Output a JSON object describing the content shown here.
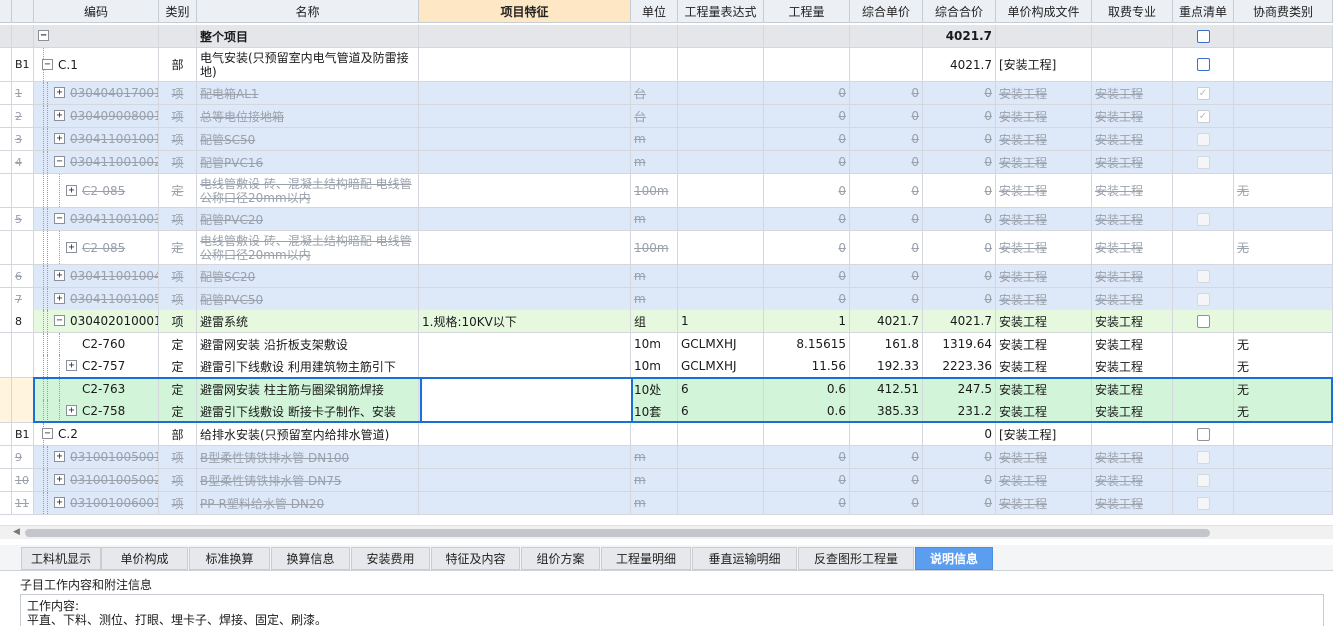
{
  "columns": {
    "code": "编码",
    "cat": "类别",
    "name": "名称",
    "feat": "项目特征",
    "unit": "单位",
    "expr": "工程量表达式",
    "qty": "工程量",
    "up": "综合单价",
    "tp": "综合合价",
    "file": "单价构成文件",
    "fee": "取费专业",
    "key": "重点清单",
    "neg": "协商费类别"
  },
  "rows": [
    {
      "seq": "",
      "code": "",
      "cat": "",
      "name": "整个项目",
      "feat": "",
      "unit": "",
      "expr": "",
      "qty": "",
      "up": "",
      "tp": "4021.7",
      "file": "",
      "fee": "",
      "neg": ""
    },
    {
      "seq": "B1",
      "code": "C.1",
      "cat": "部",
      "name": "电气安装(只预留室内电气管道及防雷接地)",
      "feat": "",
      "unit": "",
      "expr": "",
      "qty": "",
      "up": "",
      "tp": "4021.7",
      "file": "[安装工程]",
      "fee": "",
      "neg": ""
    },
    {
      "seq": "1",
      "code": "030404017001",
      "cat": "项",
      "name": "配电箱AL1",
      "feat": "",
      "unit": "台",
      "expr": "",
      "qty": "0",
      "up": "0",
      "tp": "0",
      "file": "安装工程",
      "fee": "安装工程",
      "neg": ""
    },
    {
      "seq": "2",
      "code": "030409008001",
      "cat": "项",
      "name": "总等电位接地箱",
      "feat": "",
      "unit": "台",
      "expr": "",
      "qty": "0",
      "up": "0",
      "tp": "0",
      "file": "安装工程",
      "fee": "安装工程",
      "neg": ""
    },
    {
      "seq": "3",
      "code": "030411001001",
      "cat": "项",
      "name": "配管SC50",
      "feat": "",
      "unit": "m",
      "expr": "",
      "qty": "0",
      "up": "0",
      "tp": "0",
      "file": "安装工程",
      "fee": "安装工程",
      "neg": ""
    },
    {
      "seq": "4",
      "code": "030411001002",
      "cat": "项",
      "name": "配管PVC16",
      "feat": "",
      "unit": "m",
      "expr": "",
      "qty": "0",
      "up": "0",
      "tp": "0",
      "file": "安装工程",
      "fee": "安装工程",
      "neg": ""
    },
    {
      "seq": "",
      "code": "C2-085",
      "cat": "定",
      "name": "电线管敷设 砖、混凝土结构暗配 电线管公称口径20mm以内",
      "feat": "",
      "unit": "100m",
      "expr": "",
      "qty": "0",
      "up": "0",
      "tp": "0",
      "file": "安装工程",
      "fee": "安装工程",
      "neg": "无"
    },
    {
      "seq": "5",
      "code": "030411001003",
      "cat": "项",
      "name": "配管PVC20",
      "feat": "",
      "unit": "m",
      "expr": "",
      "qty": "0",
      "up": "0",
      "tp": "0",
      "file": "安装工程",
      "fee": "安装工程",
      "neg": ""
    },
    {
      "seq": "",
      "code": "C2-085",
      "cat": "定",
      "name": "电线管敷设 砖、混凝土结构暗配 电线管公称口径20mm以内",
      "feat": "",
      "unit": "100m",
      "expr": "",
      "qty": "0",
      "up": "0",
      "tp": "0",
      "file": "安装工程",
      "fee": "安装工程",
      "neg": "无"
    },
    {
      "seq": "6",
      "code": "030411001004",
      "cat": "项",
      "name": "配管SC20",
      "feat": "",
      "unit": "m",
      "expr": "",
      "qty": "0",
      "up": "0",
      "tp": "0",
      "file": "安装工程",
      "fee": "安装工程",
      "neg": ""
    },
    {
      "seq": "7",
      "code": "030411001005",
      "cat": "项",
      "name": "配管PVC50",
      "feat": "",
      "unit": "m",
      "expr": "",
      "qty": "0",
      "up": "0",
      "tp": "0",
      "file": "安装工程",
      "fee": "安装工程",
      "neg": ""
    },
    {
      "seq": "8",
      "code": "030402010001",
      "cat": "项",
      "name": "避雷系统",
      "feat": "1.规格:10KV以下",
      "unit": "组",
      "expr": "1",
      "qty": "1",
      "up": "4021.7",
      "tp": "4021.7",
      "file": "安装工程",
      "fee": "安装工程",
      "neg": ""
    },
    {
      "seq": "",
      "code": "C2-760",
      "cat": "定",
      "name": "避雷网安装 沿折板支架敷设",
      "feat": "",
      "unit": "10m",
      "expr": "GCLMXHJ",
      "qty": "8.15615",
      "up": "161.8",
      "tp": "1319.64",
      "file": "安装工程",
      "fee": "安装工程",
      "neg": "无"
    },
    {
      "seq": "",
      "code": "C2-757",
      "cat": "定",
      "name": "避雷引下线敷设 利用建筑物主筋引下",
      "feat": "",
      "unit": "10m",
      "expr": "GCLMXHJ",
      "qty": "11.56",
      "up": "192.33",
      "tp": "2223.36",
      "file": "安装工程",
      "fee": "安装工程",
      "neg": "无"
    },
    {
      "seq": "",
      "code": "C2-763",
      "cat": "定",
      "name": "避雷网安装 柱主筋与圈梁钢筋焊接",
      "feat": "",
      "unit": "10处",
      "expr": "6",
      "qty": "0.6",
      "up": "412.51",
      "tp": "247.5",
      "file": "安装工程",
      "fee": "安装工程",
      "neg": "无"
    },
    {
      "seq": "",
      "code": "C2-758",
      "cat": "定",
      "name": "避雷引下线敷设 断接卡子制作、安装",
      "feat": "",
      "unit": "10套",
      "expr": "6",
      "qty": "0.6",
      "up": "385.33",
      "tp": "231.2",
      "file": "安装工程",
      "fee": "安装工程",
      "neg": "无"
    },
    {
      "seq": "B1",
      "code": "C.2",
      "cat": "部",
      "name": "给排水安装(只预留室内给排水管道)",
      "feat": "",
      "unit": "",
      "expr": "",
      "qty": "",
      "up": "",
      "tp": "0",
      "file": "[安装工程]",
      "fee": "",
      "neg": ""
    },
    {
      "seq": "9",
      "code": "031001005001",
      "cat": "项",
      "name": "B型柔性铸铁排水管 DN100",
      "feat": "",
      "unit": "m",
      "expr": "",
      "qty": "0",
      "up": "0",
      "tp": "0",
      "file": "安装工程",
      "fee": "安装工程",
      "neg": ""
    },
    {
      "seq": "10",
      "code": "031001005002",
      "cat": "项",
      "name": "B型柔性铸铁排水管 DN75",
      "feat": "",
      "unit": "m",
      "expr": "",
      "qty": "0",
      "up": "0",
      "tp": "0",
      "file": "安装工程",
      "fee": "安装工程",
      "neg": ""
    },
    {
      "seq": "11",
      "code": "031001006001",
      "cat": "项",
      "name": "PP-R塑料给水管 DN20",
      "feat": "",
      "unit": "m",
      "expr": "",
      "qty": "0",
      "up": "0",
      "tp": "0",
      "file": "安装工程",
      "fee": "安装工程",
      "neg": ""
    }
  ],
  "tabs": [
    "工料机显示",
    "单价构成",
    "标准换算",
    "换算信息",
    "安装费用",
    "特征及内容",
    "组价方案",
    "工程量明细",
    "垂直运输明细",
    "反查图形工程量",
    "说明信息"
  ],
  "active_tab": "说明信息",
  "info": {
    "title": "子目工作内容和附注信息",
    "line1": "工作内容:",
    "line2": "平直、下料、测位、打眼、埋卡子、焊接、固定、刷漆。"
  },
  "colors": {
    "accent": "#1a6fd4",
    "tab_active": "#5b9ef0"
  }
}
